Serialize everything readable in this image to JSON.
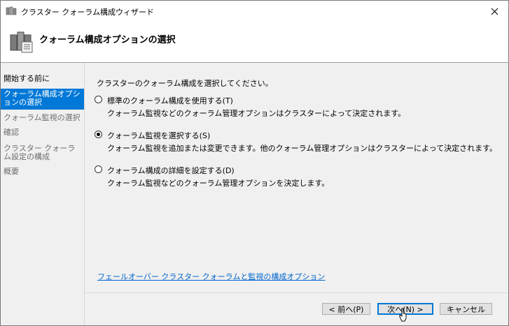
{
  "window": {
    "title": "クラスター クォーラム構成ウィザード"
  },
  "header": {
    "heading": "クォーラム構成オプションの選択"
  },
  "nav": {
    "items": [
      {
        "label": "開始する前に",
        "state": "done"
      },
      {
        "label": "クォーラム構成オプションの選択",
        "state": "active"
      },
      {
        "label": "クォーラム監視の選択",
        "state": "pending"
      },
      {
        "label": "確認",
        "state": "pending"
      },
      {
        "label": "クラスター クォーラム設定の構成",
        "state": "pending"
      },
      {
        "label": "概要",
        "state": "pending"
      }
    ]
  },
  "main": {
    "instruction": "クラスターのクォーラム構成を選択してください。",
    "options": [
      {
        "label": "標準のクォーラム構成を使用する(T)",
        "description": "クォーラム監視などのクォーラム管理オプションはクラスターによって決定されます。",
        "checked": false
      },
      {
        "label": "クォーラム監視を選択する(S)",
        "description": "クォーラム監視を追加または変更できます。他のクォーラム管理オプションはクラスターによって決定されます。",
        "checked": true
      },
      {
        "label": "クォーラム構成の詳細を設定する(D)",
        "description": "クォーラム監視などのクォーラム管理オプションを決定します。",
        "checked": false
      }
    ],
    "link": "フェールオーバー クラスター クォーラムと監視の構成オプション"
  },
  "buttons": {
    "back": "< 前へ(P)",
    "next": "次へ(N) >",
    "cancel": "キャンセル"
  },
  "colors": {
    "accent": "#0078d7",
    "link": "#0066cc",
    "panel": "#f0f0f0"
  }
}
